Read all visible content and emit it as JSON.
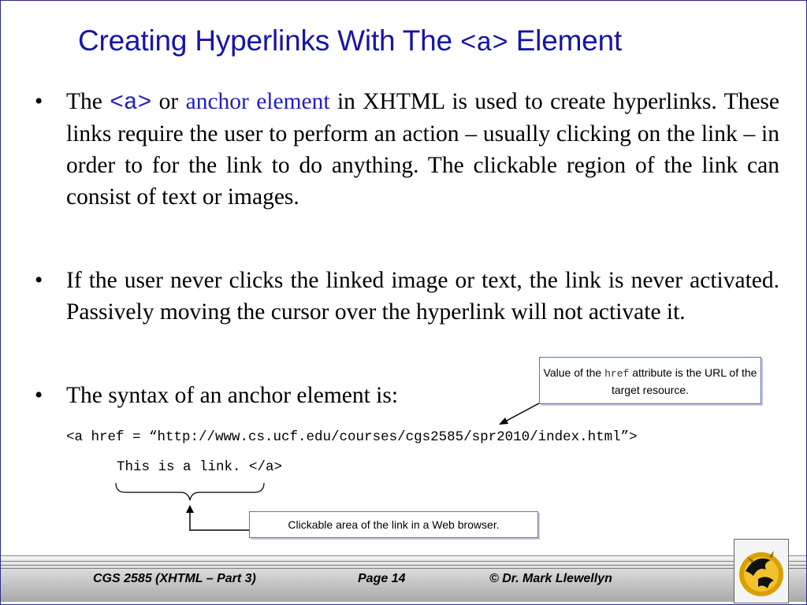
{
  "title": {
    "prefix": "Creating Hyperlinks With The ",
    "code": "<a>",
    "suffix": " Element"
  },
  "bullets": [
    {
      "dot": "•",
      "seg1": "The ",
      "code": "<a>",
      "seg2": " or ",
      "term": "anchor element",
      "seg3": " in XHTML is used to create hyperlinks.  These links require the user to perform an action – usually clicking on the link – in order to for the link to do anything.  The clickable region of the link can consist of text or images."
    },
    {
      "dot": "•",
      "text": "If the user never clicks the linked image or text, the link is never activated. Passively moving the cursor over the hyperlink will not activate it."
    },
    {
      "dot": "•",
      "text": "The syntax of an anchor element is:"
    }
  ],
  "code": {
    "line1": "<a href = “http://www.cs.ucf.edu/courses/cgs2585/spr2010/index.html”>",
    "line2": "This is a link. </a>"
  },
  "callouts": {
    "href": {
      "prefix": "Value of the ",
      "code": "href",
      "suffix": "  attribute is the URL of the target resource."
    },
    "clickable": {
      "text": "Clickable area of the link in a Web browser."
    }
  },
  "footer": {
    "course": "CGS 2585 (XHTML – Part 3)",
    "page": "Page 14",
    "author": "© Dr. Mark Llewellyn"
  },
  "logo": {
    "icon": "pegasus-logo-icon"
  },
  "colors": {
    "title": "#1515a8",
    "accent_blue": "#2020c0",
    "logo_gold": "#d8a000"
  }
}
